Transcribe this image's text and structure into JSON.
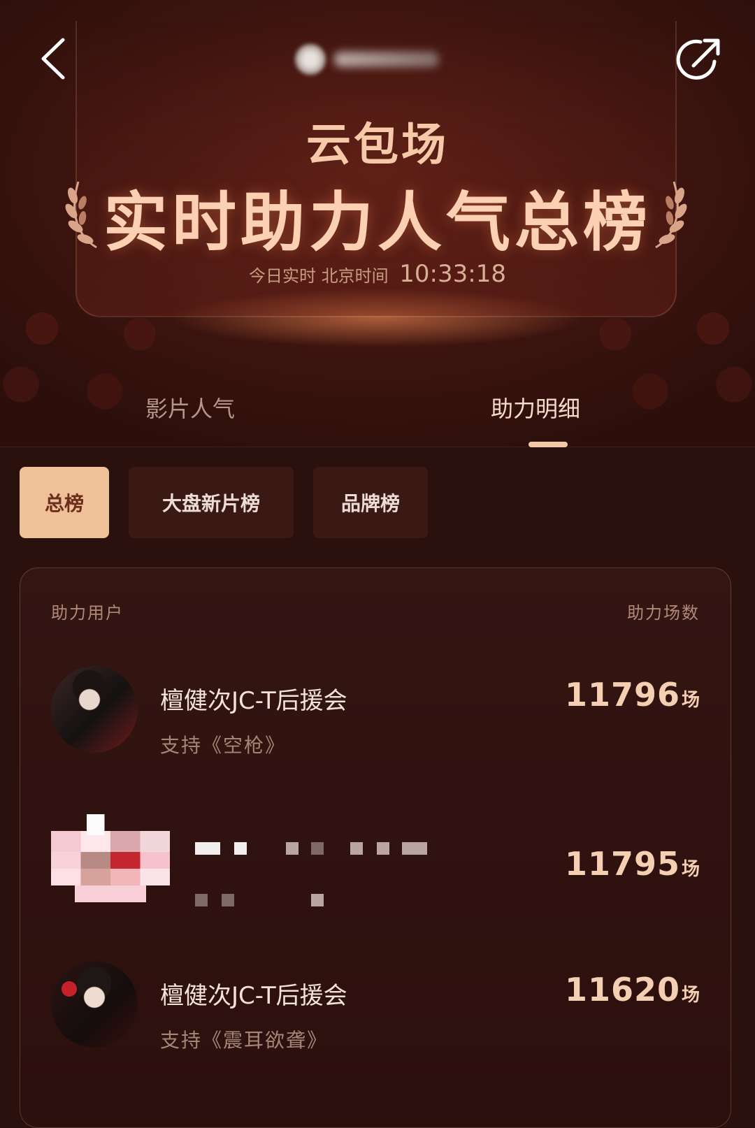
{
  "header": {
    "sub_title": "云包场",
    "main_title": "实时助力人气总榜",
    "time_label": "今日实时 北京时间",
    "time_value": "10:33:18",
    "back_icon": "chevron-left-icon",
    "share_icon": "share-icon"
  },
  "tabs": [
    {
      "label": "影片人气",
      "active": false
    },
    {
      "label": "助力明细",
      "active": true
    }
  ],
  "filters": [
    {
      "label": "总榜",
      "active": true
    },
    {
      "label": "大盘新片榜",
      "active": false
    },
    {
      "label": "品牌榜",
      "active": false
    }
  ],
  "table": {
    "col_user": "助力用户",
    "col_count": "助力场数",
    "unit": "场",
    "rows": [
      {
        "name": "檀健次JC-T后援会",
        "support": "支持《空枪》",
        "count": "11796"
      },
      {
        "name": "",
        "support": "",
        "count": "11795"
      },
      {
        "name": "檀健次JC-T后援会",
        "support": "支持《震耳欲聋》",
        "count": "11620"
      }
    ]
  },
  "colors": {
    "accent": "#f0c099",
    "background": "#2a110d",
    "title": "#fbd0b3"
  }
}
